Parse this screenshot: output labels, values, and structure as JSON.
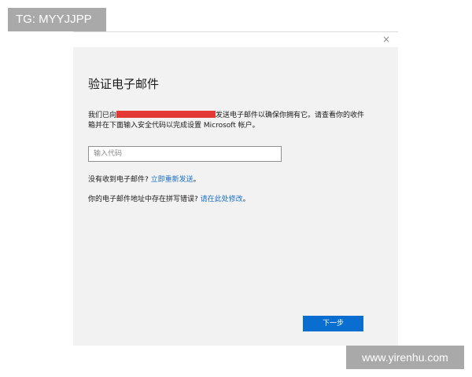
{
  "overlay": {
    "tg_label": "TG: MYYJJPP",
    "watermark": "www.yirenhu.com"
  },
  "dialog": {
    "close_icon": "×",
    "title": "验证电子邮件",
    "description": {
      "before_email": "我们已向",
      "after_email": "发送电子邮件以确保你拥有它。请查看你的收件箱并在下面输入安全代码以完成设置 Microsoft 帐户。"
    },
    "code_input": {
      "placeholder": "输入代码",
      "value": ""
    },
    "resend": {
      "prompt": "没有收到电子邮件? ",
      "link": "立即重新发送",
      "suffix": "。"
    },
    "edit": {
      "prompt": "你的电子邮件地址中存在拼写错误? ",
      "link": "请在此处修改",
      "suffix": "。"
    },
    "next_button": "下一步"
  },
  "colors": {
    "dialog_bg": "#f2f2f2",
    "accent": "#0a6ed1",
    "link": "#1a6fc4",
    "redaction": "#e53935",
    "overlay_bg": "#a9a9a9"
  }
}
